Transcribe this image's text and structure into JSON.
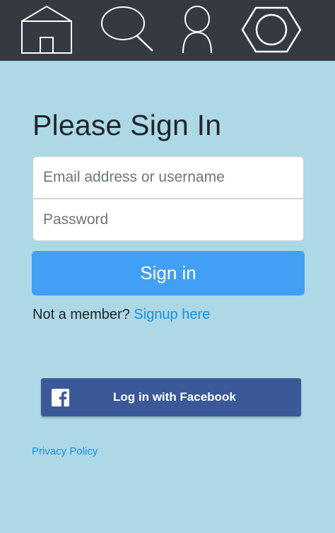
{
  "nav": {
    "items": [
      {
        "icon": "home-icon"
      },
      {
        "icon": "search-icon"
      },
      {
        "icon": "user-icon"
      },
      {
        "icon": "settings-icon"
      }
    ]
  },
  "login": {
    "title": "Please Sign In",
    "email_placeholder": "Email address or username",
    "email_value": "",
    "password_placeholder": "Password",
    "password_value": "",
    "signin_label": "Sign in",
    "member_text": "Not a member?",
    "signup_link": "Signup here"
  },
  "facebook": {
    "label": "Log in with Facebook",
    "icon": "facebook-icon"
  },
  "footer": {
    "privacy_link": "Privacy Policy"
  },
  "colors": {
    "background": "#add8e6",
    "topbar": "#343a40",
    "primary_button": "#42a0f4",
    "link": "#1a8fe3",
    "facebook": "#3b5998"
  }
}
